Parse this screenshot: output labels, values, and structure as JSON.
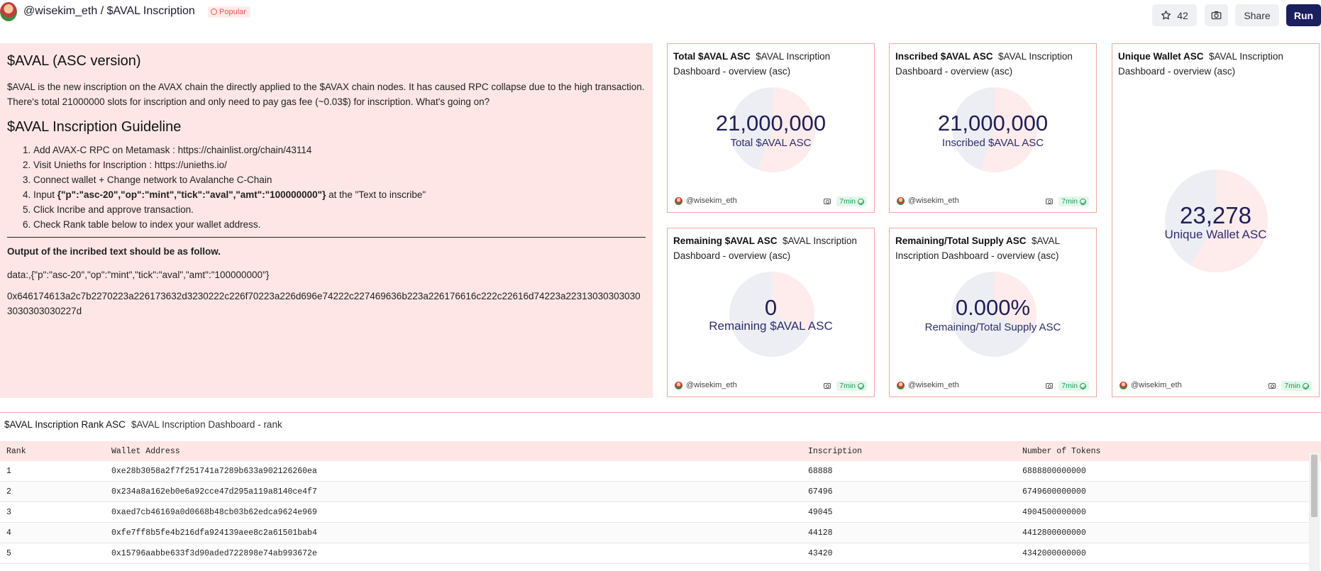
{
  "header": {
    "title": "@wisekim_eth / $AVAL Inscription",
    "badge": "Popular",
    "star_count": "42",
    "share_label": "Share",
    "run_label": "Run"
  },
  "text_panel": {
    "heading": "$AVAL (ASC version)",
    "intro": "$AVAL is the new inscription on the AVAX chain the directly applied to the $AVAX chain nodes. It has caused RPC collapse due to the high transaction. There's total 21000000 slots for inscription and only need to pay gas fee (~0.03$) for inscription. What's going on?",
    "guide_heading": "$AVAL Inscription Guideline",
    "steps": [
      "Add AVAX-C RPC on Metamask : https://chainlist.org/chain/43114",
      "Visit Unieths for Inscription : https://unieths.io/",
      "Connect wallet + Change network to Avalanche C-Chain",
      "Click Incribe and approve transaction.",
      "Check Rank table below to index your wallet address."
    ],
    "step4_prefix": "Input ",
    "step4_code": "{\"p\":\"asc-20\",\"op\":\"mint\",\"tick\":\"aval\",\"amt\":\"100000000\"}",
    "step4_suffix": " at the \"Text to inscribe\"",
    "output_title": "Output of the incribed text should be as follow.",
    "output_data": "data:,{\"p\":\"asc-20\",\"op\":\"mint\",\"tick\":\"aval\",\"amt\":\"100000000\"}",
    "output_hex": "0x646174613a2c7b2270223a226173632d3230222c226f70223a226d696e74222c227469636b223a226176616c222c22616d74223a223130303030303030303030227d"
  },
  "cards": {
    "total": {
      "title_bold": "Total $AVAL ASC",
      "title_rest": "$AVAL Inscription Dashboard - overview (asc)",
      "value": "21,000,000",
      "label": "Total $AVAL ASC",
      "user": "@wisekim_eth",
      "time": "7min"
    },
    "inscribed": {
      "title_bold": "Inscribed $AVAL ASC",
      "title_rest": "$AVAL Inscription Dashboard - overview (asc)",
      "value": "21,000,000",
      "label": "Inscribed $AVAL ASC",
      "user": "@wisekim_eth",
      "time": "7min"
    },
    "unique": {
      "title_bold": "Unique Wallet ASC",
      "title_rest": "$AVAL Inscription Dashboard - overview (asc)",
      "value": "23,278",
      "label": "Unique Wallet ASC",
      "user": "@wisekim_eth",
      "time": "7min"
    },
    "remaining": {
      "title_bold": "Remaining $AVAL ASC",
      "title_rest": "$AVAL Inscription Dashboard - overview (asc)",
      "value": "0",
      "label": "Remaining $AVAL ASC",
      "user": "@wisekim_eth",
      "time": "7min"
    },
    "ratio": {
      "title_bold": "Remaining/Total Supply ASC",
      "title_rest": "$AVAL Inscription Dashboard - overview (asc)",
      "value": "0.000%",
      "label": "Remaining/Total Supply ASC",
      "user": "@wisekim_eth",
      "time": "7min"
    }
  },
  "rank": {
    "title": "$AVAL Inscription Rank ASC",
    "subtitle": "$AVAL Inscription Dashboard - rank",
    "columns": [
      "Rank",
      "Wallet Address",
      "Inscription",
      "Number of Tokens"
    ],
    "rows": [
      [
        "1",
        "0xe28b3058a2f7f251741a7289b633a902126260ea",
        "68888",
        "6888800000000"
      ],
      [
        "2",
        "0x234a8a162eb0e6a92cce47d295a119a8140ce4f7",
        "67496",
        "6749600000000"
      ],
      [
        "3",
        "0xaed7cb46169a0d0668b48cb03b62edca9624e969",
        "49045",
        "4904500000000"
      ],
      [
        "4",
        "0xfe7ff8b5fe4b216dfa924139aee8c2a61501bab4",
        "44128",
        "4412800000000"
      ],
      [
        "5",
        "0x15796aabbe633f3d90aded722898e74ab993672e",
        "43420",
        "4342000000000"
      ]
    ]
  },
  "colors": {
    "accent": "#1a1f5e",
    "panel_bg": "#fde6e5",
    "card_border": "#f2a7a2",
    "value_text": "#1f1f57"
  }
}
